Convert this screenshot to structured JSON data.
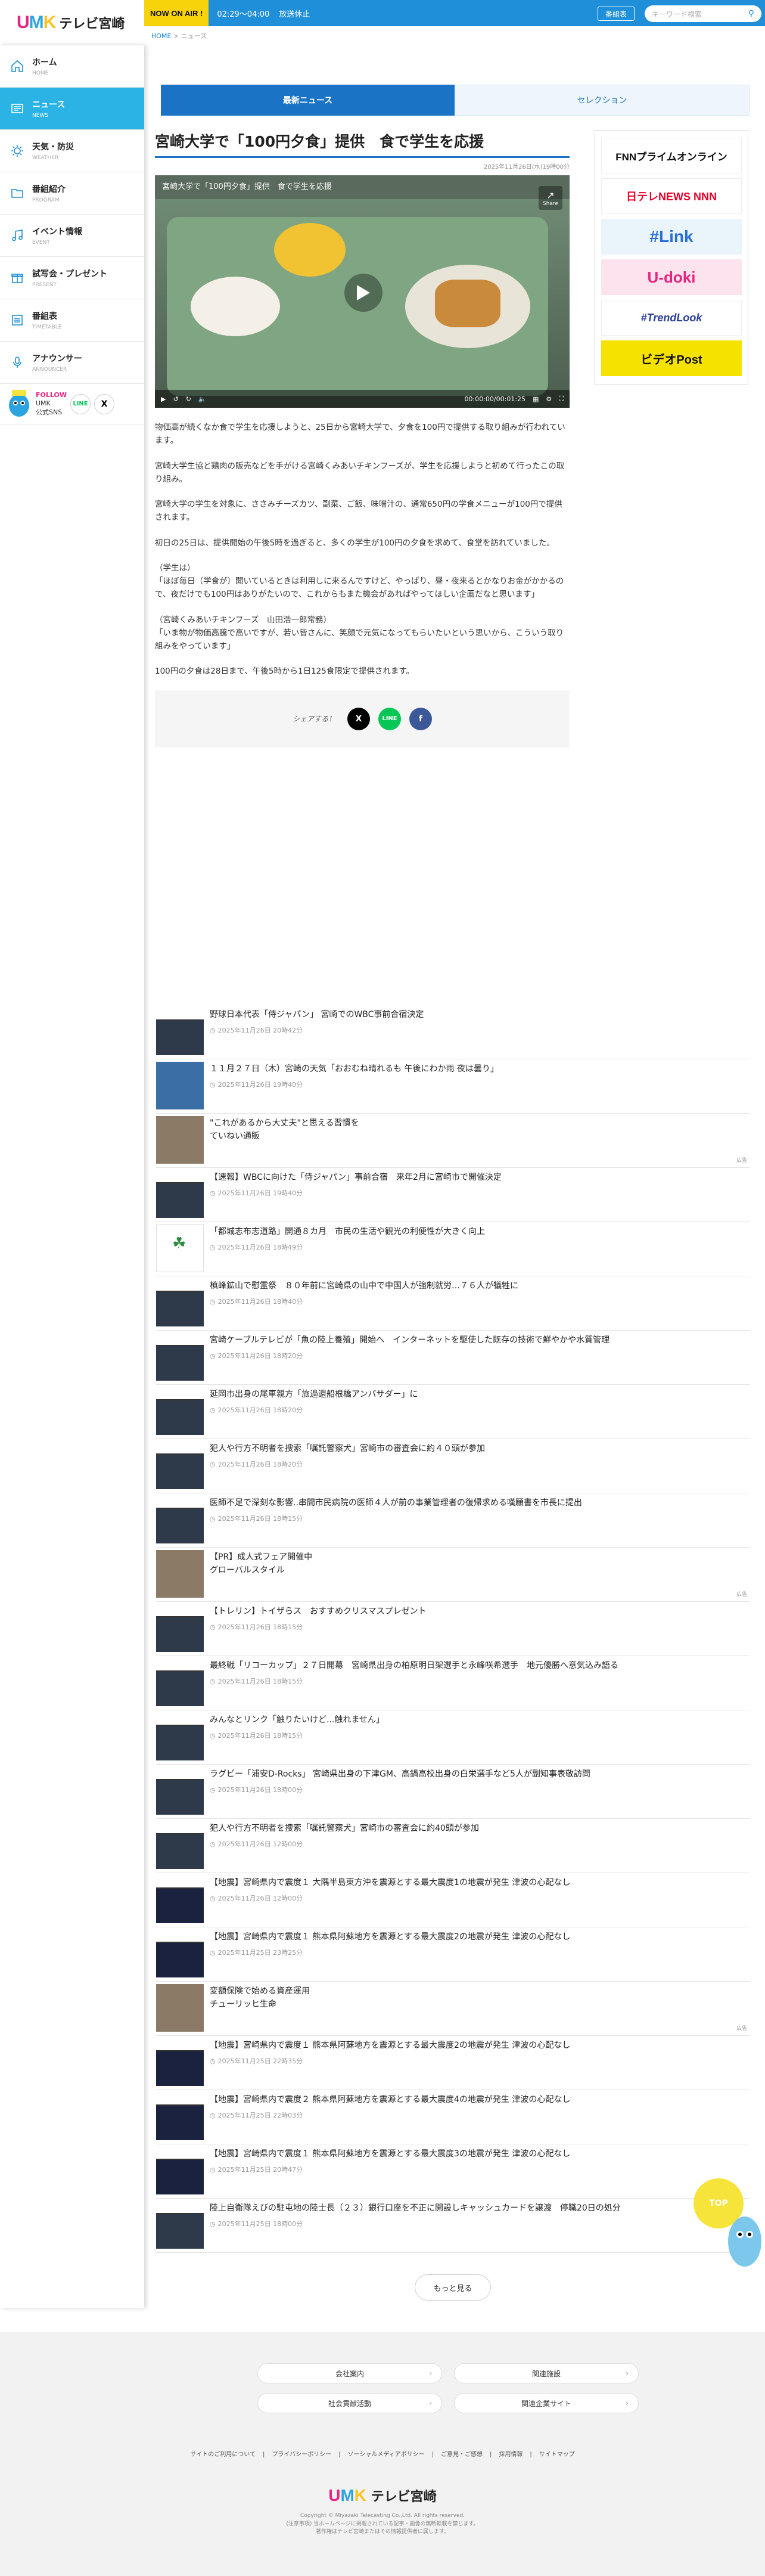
{
  "header": {
    "logo": {
      "u": "U",
      "m": "M",
      "k": "K",
      "tv": "テレビ宮崎"
    },
    "now_on_air": "NOW ON AIR !",
    "time": "02:29〜04:00",
    "status": "放送休止",
    "bangumi_button": "番組表",
    "search_placeholder": "キーワード検索"
  },
  "breadcrumb": {
    "home": "HOME",
    "sep": " > ",
    "current": "ニュース"
  },
  "sidebar": {
    "items": [
      {
        "label": "ホーム",
        "sub": "HOME"
      },
      {
        "label": "ニュース",
        "sub": "NEWS"
      },
      {
        "label": "天気・防災",
        "sub": "WEATHER"
      },
      {
        "label": "番組紹介",
        "sub": "PROGRAM"
      },
      {
        "label": "イベント情報",
        "sub": "EVENT"
      },
      {
        "label": "試写会・プレゼント",
        "sub": "PRESENT"
      },
      {
        "label": "番組表",
        "sub": "TIMETABLE"
      },
      {
        "label": "アナウンサー",
        "sub": "ANNOUNCER"
      }
    ],
    "follow": {
      "line1": "FOLLOW",
      "line2": "UMK",
      "line3": "公式SNS",
      "line": "LINE",
      "x": "X"
    }
  },
  "tabs": {
    "latest": "最新ニュース",
    "selection": "セレクション"
  },
  "article": {
    "title": "宮崎大学で「100円夕食」提供　食で学生を応援",
    "date": "2025年11月26日(水)19時00分",
    "video": {
      "title": "宮崎大学で「100円夕食」提供　食で学生を応援",
      "share": "Share",
      "time": "00:00:00/00:01:25"
    },
    "paragraphs": [
      "物価高が続くなか食で学生を応援しようと、25日から宮崎大学で、夕食を100円で提供する取り組みが行われています。",
      "宮崎大学生協と鶏肉の販売などを手がける宮崎くみあいチキンフーズが、学生を応援しようと初めて行ったこの取り組み。",
      "宮崎大学の学生を対象に、ささみチーズカツ、副菜、ご飯、味噌汁の、通常650円の学食メニューが100円で提供されます。",
      "初日の25日は、提供開始の午後5時を過ぎると、多くの学生が100円の夕食を求めて、食堂を訪れていました。",
      "（学生は）\n「ほぼ毎日（学食が）開いているときは利用しに来るんですけど、やっぱり、昼・夜来るとかなりお金がかかるので、夜だけでも100円はありがたいので、これからもまた機会があればやってほしい企画だなと思います」",
      "（宮崎くみあいチキンフーズ　山田浩一郎常務）\n「いま物が物価高騰で高いですが、若い皆さんに、笑顔で元気になってもらいたいという思いから、こういう取り組みをやっています」",
      "100円の夕食は28日まで、午後5時から1日125食限定で提供されます。"
    ],
    "share_label": "シェアする！"
  },
  "ads": [
    "FNNプライムオンライン",
    "日テレNEWS NNN",
    "#Link",
    "U-doki",
    "#TrendLook",
    "ビデオPost"
  ],
  "news": [
    {
      "title": "野球日本代表「侍ジャパン」 宮崎でのWBC事前合宿決定",
      "date": "2025年11月26日 20時42分",
      "thumb": "news"
    },
    {
      "title": "１１月２７日（木）宮崎の天気「おおむね晴れるも 午後にわか雨 夜は曇り」",
      "date": "2025年11月26日 19時40分",
      "thumb": "weather"
    },
    {
      "title": "\"これがあるから大丈夫\"と思える習慣を\nていねい通販",
      "date": "",
      "thumb": "ad",
      "ad": "広告"
    },
    {
      "title": "【速報】WBCに向けた「侍ジャパン」事前合宿　来年2月に宮崎市で開催決定",
      "date": "2025年11月26日 19時40分",
      "thumb": "news"
    },
    {
      "title": "「都城志布志道路」開通８カ月　市民の生活や観光の利便性が大きく向上",
      "date": "2025年11月26日 18時49分",
      "thumb": "miyazaki"
    },
    {
      "title": "槙峰鉱山で慰霊祭　８０年前に宮崎県の山中で中国人が強制就労…７６人が犠牲に",
      "date": "2025年11月26日 18時40分",
      "thumb": "news"
    },
    {
      "title": "宮崎ケーブルテレビが「魚の陸上養殖」開始へ　インターネットを駆使した既存の技術で鮮やかや水質管理",
      "date": "2025年11月26日 18時20分",
      "thumb": "news"
    },
    {
      "title": "延岡市出身の尾車親方「旅過還船根橋アンバサダー」に",
      "date": "2025年11月26日 18時20分",
      "thumb": "news"
    },
    {
      "title": "犯人や行方不明者を捜索「嘱託警察犬」宮崎市の審査会に約４０頭が参加",
      "date": "2025年11月26日 18時20分",
      "thumb": "news"
    },
    {
      "title": "医師不足で深刻な影響..串間市民病院の医師４人が前の事業管理者の復帰求める嘆願書を市長に提出",
      "date": "2025年11月26日 18時15分",
      "thumb": "news"
    },
    {
      "title": "【PR】成人式フェア開催中\nグローバルスタイル",
      "date": "",
      "thumb": "ad",
      "ad": "広告"
    },
    {
      "title": "【トレリン】トイザらス　おすすめクリスマスプレゼント",
      "date": "2025年11月26日 18時15分",
      "thumb": "news"
    },
    {
      "title": "最終戦「リコーカップ」２７日開幕　宮崎県出身の柏原明日架選手と永峰咲希選手　地元優勝へ意気込み語る",
      "date": "2025年11月26日 18時15分",
      "thumb": "news"
    },
    {
      "title": "みんなとリンク「触りたいけど...触れません」",
      "date": "2025年11月26日 18時15分",
      "thumb": "news"
    },
    {
      "title": "ラグビー「浦安D-Rocks」 宮崎県出身の下津GM、高鍋高校出身の白栄選手など5人が副知事表敬訪問",
      "date": "2025年11月26日 18時00分",
      "thumb": "news"
    },
    {
      "title": "犯人や行方不明者を捜索「嘱託警察犬」宮崎市の審査会に約40頭が参加",
      "date": "2025年11月26日 12時00分",
      "thumb": "news"
    },
    {
      "title": "【地震】宮崎県内で震度１ 大隅半島東方沖を震源とする最大震度1の地震が発生 津波の心配なし",
      "date": "2025年11月26日 12時00分",
      "thumb": "quake"
    },
    {
      "title": "【地震】宮崎県内で震度１ 熊本県阿蘇地方を震源とする最大震度2の地震が発生 津波の心配なし",
      "date": "2025年11月25日 23時25分",
      "thumb": "quake"
    },
    {
      "title": "変額保険で始める資産運用\nチューリッヒ生命",
      "date": "",
      "thumb": "ad",
      "ad": "広告"
    },
    {
      "title": "【地震】宮崎県内で震度１ 熊本県阿蘇地方を震源とする最大震度2の地震が発生 津波の心配なし",
      "date": "2025年11月25日 22時35分",
      "thumb": "quake"
    },
    {
      "title": "【地震】宮崎県内で震度２ 熊本県阿蘇地方を震源とする最大震度4の地震が発生 津波の心配なし",
      "date": "2025年11月25日 22時03分",
      "thumb": "quake"
    },
    {
      "title": "【地震】宮崎県内で震度１ 熊本県阿蘇地方を震源とする最大震度3の地震が発生 津波の心配なし",
      "date": "2025年11月25日 20時47分",
      "thumb": "quake"
    },
    {
      "title": "陸上自衛隊えびの駐屯地の陸士長（２３）銀行口座を不正に開設しキャッシュカードを譲渡　停職20日の処分",
      "date": "2025年11月25日 18時00分",
      "thumb": "news"
    }
  ],
  "more_button": "もっと見る",
  "footer": {
    "buttons": [
      "会社案内",
      "関連施設",
      "社会貢献活動",
      "関連企業サイト"
    ],
    "links": [
      "サイトのご利用について",
      "プライバシーポリシー",
      "ソーシャルメディアポリシー",
      "ご意見・ご感想",
      "採用情報",
      "サイトマップ"
    ],
    "copyright": "Copyright © Miyazaki Telecasting Co.,Ltd. All rights reserved.",
    "notice1": "(注意事項) 当ホームページに掲載されている記事・画像の無断転載を禁じます。",
    "notice2": "著作権はテレビ宮崎またはその情報提供者に属します。"
  },
  "top_button": "TOP",
  "colors": {
    "brand_blue": "#1e8fd8",
    "active_nav": "#2bb3e6",
    "accent_pink": "#e8247f"
  }
}
